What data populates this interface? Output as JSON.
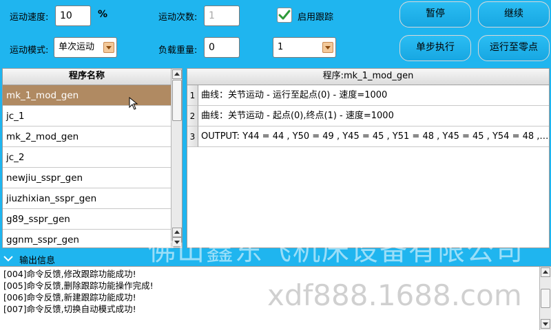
{
  "controls": {
    "speed_label": "运动速度:",
    "speed_value": "10",
    "speed_unit": "%",
    "count_label": "运动次数:",
    "count_value": "1",
    "tracking_label": "启用跟踪",
    "tracking_checked": true,
    "mode_label": "运动模式:",
    "mode_value": "单次运动",
    "load_label": "负载重量:",
    "load_value": "0",
    "load_select_value": "1"
  },
  "buttons": {
    "pause": "暂停",
    "resume": "继续",
    "step": "单步执行",
    "home": "运行至零点"
  },
  "program_list": {
    "header": "程序名称",
    "items": [
      "mk_1_mod_gen",
      "jc_1",
      "mk_2_mod_gen",
      "jc_2",
      "newjiu_sspr_gen",
      "jiuzhixian_sspr_gen",
      "g89_sspr_gen",
      "ggnm_sspr_gen"
    ],
    "selected_index": 0
  },
  "program_detail": {
    "header": "程序:mk_1_mod_gen",
    "rows": [
      {
        "num": "1",
        "text": "曲线：关节运动 - 运行至起点(0) - 速度=1000"
      },
      {
        "num": "2",
        "text": "曲线：关节运动 - 起点(0),终点(1) - 速度=1000"
      },
      {
        "num": "3",
        "text": "OUTPUT: Y44 = 44 , Y50 = 49 , Y45 = 45 , Y51 = 48 , Y45 = 45 , Y54 = 48 , ..."
      }
    ]
  },
  "output": {
    "title": "输出信息",
    "lines": [
      "[004]命令反馈,修改跟踪功能成功!",
      "[005]命令反馈,删除跟踪功能操作完成!",
      "[006]命令反馈,新建跟踪功能成功!",
      "[007]命令反馈,切换自动模式成功!"
    ]
  },
  "watermark": {
    "company": "佛山鑫东飞机床设备有限公司",
    "site": "xdf888.1688.com"
  },
  "colors": {
    "background": "#1fb5ef",
    "selected_row": "#b08a62",
    "check": "#2e9a3a"
  }
}
